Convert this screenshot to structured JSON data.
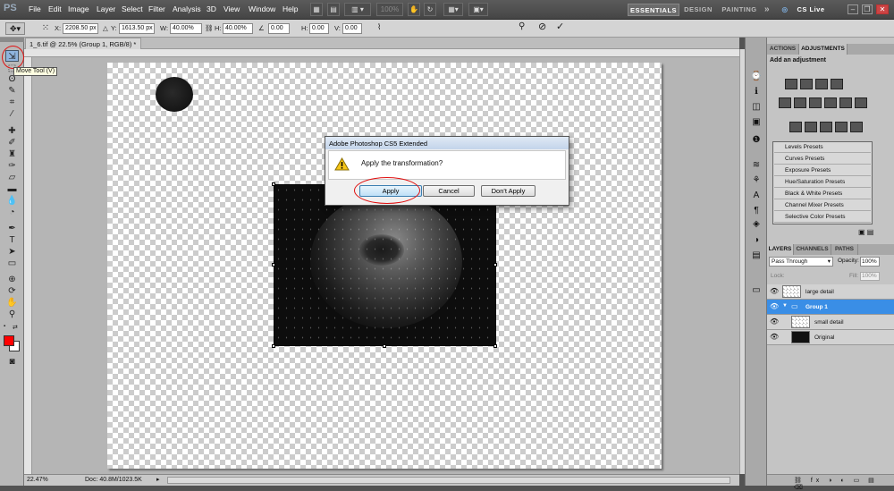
{
  "app": {
    "logo": "PS"
  },
  "menus": [
    "File",
    "Edit",
    "Image",
    "Layer",
    "Select",
    "Filter",
    "Analysis",
    "3D",
    "View",
    "Window",
    "Help"
  ],
  "menubar": {
    "zoom": "100%",
    "workspaces": [
      "ESSENTIALS",
      "DESIGN",
      "PAINTING"
    ],
    "more": "»",
    "cslive": "CS Live"
  },
  "options": {
    "x_label": "X:",
    "x_value": "2208.50 px",
    "y_label": "Y:",
    "y_value": "1613.50 px",
    "w_label": "W:",
    "w_value": "40.00%",
    "h_label": "H:",
    "h_value": "40.00%",
    "angle_value": "0.00",
    "hskew_label": "H:",
    "hskew_value": "0.00",
    "vskew_label": "V:",
    "vskew_value": "0.00"
  },
  "document": {
    "tab_title": "1_6.tif @ 22.5% (Group 1, RGB/8) *",
    "close": "×"
  },
  "tooltip": "Move Tool (V)",
  "status": {
    "zoom": "22.47%",
    "doc_size": "Doc: 40.8M/1023.5K"
  },
  "dialog": {
    "title": "Adobe Photoshop CS5 Extended",
    "message": "Apply the transformation?",
    "apply": "Apply",
    "cancel": "Cancel",
    "dont_apply": "Don't Apply"
  },
  "adjustments_panel": {
    "tabs": [
      "ACTIONS",
      "ADJUSTMENTS"
    ],
    "heading": "Add an adjustment",
    "presets": [
      "Levels Presets",
      "Curves Presets",
      "Exposure Presets",
      "Hue/Saturation Presets",
      "Black & White Presets",
      "Channel Mixer Presets",
      "Selective Color Presets"
    ]
  },
  "layers_panel": {
    "tabs": [
      "LAYERS",
      "CHANNELS",
      "PATHS"
    ],
    "blend_mode": "Pass Through",
    "opacity_label": "Opacity:",
    "opacity_value": "100%",
    "lock_label": "Lock:",
    "fill_label": "Fill:",
    "fill_value": "100%",
    "layers": [
      {
        "name": "large detail",
        "selected": false
      },
      {
        "name": "Group 1",
        "selected": true
      },
      {
        "name": "small detail",
        "selected": false
      },
      {
        "name": "Original",
        "selected": false
      }
    ]
  },
  "colors": {
    "foreground": "#ff0000",
    "background": "#ffffff",
    "selection": "#3a8ee6",
    "highlight": "#e01010"
  }
}
